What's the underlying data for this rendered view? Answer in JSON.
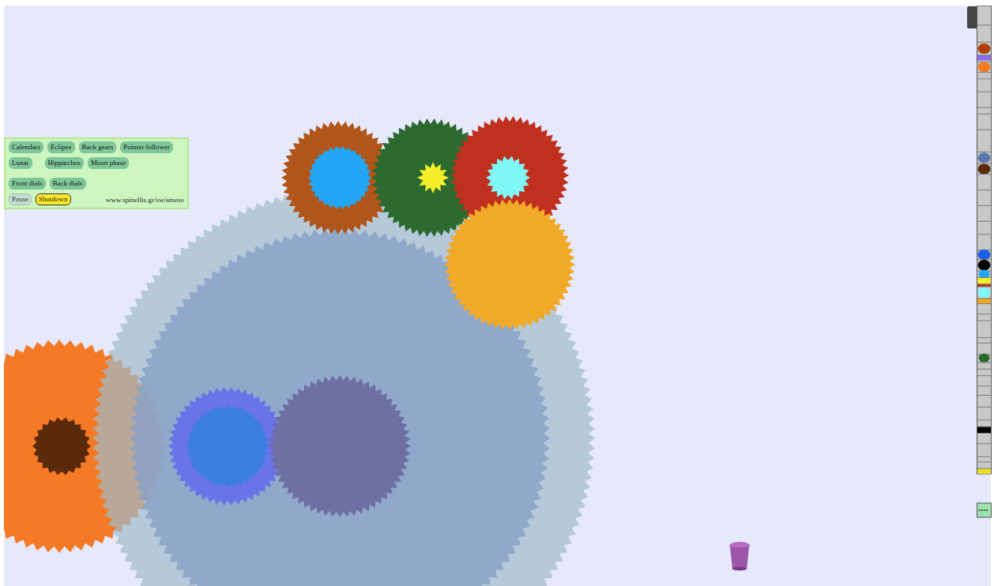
{
  "control_panel": {
    "button_rows": [
      [
        {
          "label": "Calendars",
          "kind": "view"
        },
        {
          "label": "Eclipse",
          "kind": "view"
        },
        {
          "label": "Back gears",
          "kind": "view"
        },
        {
          "label": "Pointer follower",
          "kind": "view"
        }
      ],
      [
        {
          "label": "Lunar",
          "kind": "view"
        },
        {
          "label": "Hipparchos",
          "kind": "view"
        },
        {
          "label": "Moon phase",
          "kind": "view"
        }
      ],
      [
        {
          "label": "Front dials",
          "kind": "view"
        },
        {
          "label": "Back dials",
          "kind": "view"
        }
      ],
      [
        {
          "label": "Pause",
          "kind": "control"
        },
        {
          "label": "Shutdown",
          "kind": "alert"
        }
      ]
    ],
    "url": "www.spinellis.gr/sw/ameso"
  }
}
